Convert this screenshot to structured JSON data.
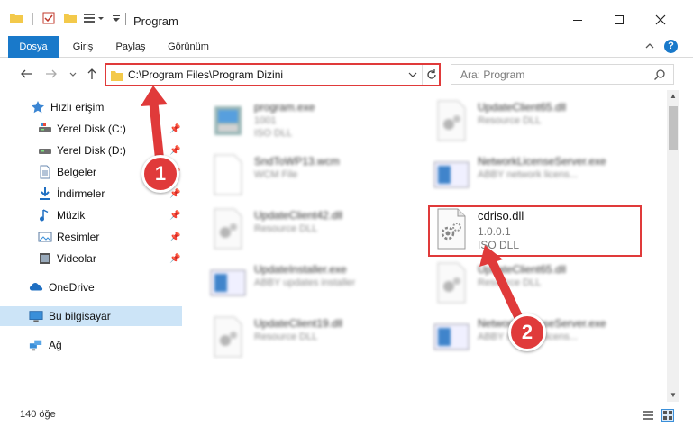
{
  "window": {
    "title": "Program",
    "minimize_icon": "minimize-icon",
    "maximize_icon": "maximize-icon",
    "close_icon": "close-icon"
  },
  "ribbon": {
    "tabs": [
      {
        "label": "Dosya",
        "active": true
      },
      {
        "label": "Giriş",
        "active": false
      },
      {
        "label": "Paylaş",
        "active": false
      },
      {
        "label": "Görünüm",
        "active": false
      }
    ],
    "help_icon": "?"
  },
  "nav": {
    "address": "C:\\Program Files\\Program Dizini",
    "search_placeholder": "Ara: Program"
  },
  "sidebar": {
    "items": [
      {
        "label": "Hızlı erişim",
        "icon": "star-icon"
      },
      {
        "label": "Yerel Disk (C:)",
        "icon": "drive-icon"
      },
      {
        "label": "Yerel Disk (D:)",
        "icon": "drive-icon"
      },
      {
        "label": "Belgeler",
        "icon": "document-icon"
      },
      {
        "label": "İndirmeler",
        "icon": "download-icon"
      },
      {
        "label": "Müzik",
        "icon": "music-icon"
      },
      {
        "label": "Resimler",
        "icon": "pictures-icon"
      },
      {
        "label": "Videolar",
        "icon": "video-icon"
      },
      {
        "label": "OneDrive",
        "icon": "cloud-icon"
      },
      {
        "label": "Bu bilgisayar",
        "icon": "computer-icon"
      },
      {
        "label": "Ağ",
        "icon": "network-icon"
      }
    ]
  },
  "files": [
    {
      "name": "program.exe",
      "line2": "1001",
      "line3": "ISO DLL"
    },
    {
      "name": "UpdateClient65.dll",
      "line2": "Resource DLL",
      "line3": ""
    },
    {
      "name": "SndToWP13.wcm",
      "line2": "WCM File",
      "line3": ""
    },
    {
      "name": "NetworkLicenseServer.exe",
      "line2": "ABBY network licens...",
      "line3": ""
    },
    {
      "name": "UpdateClient42.dll",
      "line2": "Resource DLL",
      "line3": ""
    },
    {
      "name": "cdriso.dll",
      "line2": "1.0.0.1",
      "line3": "ISO DLL"
    },
    {
      "name": "UpdateInstaller.exe",
      "line2": "ABBY updates installer",
      "line3": ""
    },
    {
      "name": "UpdateClient65.dll",
      "line2": "Resource DLL",
      "line3": ""
    },
    {
      "name": "UpdateClient19.dll",
      "line2": "Resource DLL",
      "line3": ""
    },
    {
      "name": "NetworkLicenseServer.exe",
      "line2": "ABBY network licens...",
      "line3": ""
    }
  ],
  "status": {
    "item_count": "140 öğe"
  },
  "callouts": {
    "step1": "1",
    "step2": "2"
  },
  "colors": {
    "accent": "#1979ca",
    "highlight": "#e03a3a",
    "folder": "#f3c94a"
  }
}
